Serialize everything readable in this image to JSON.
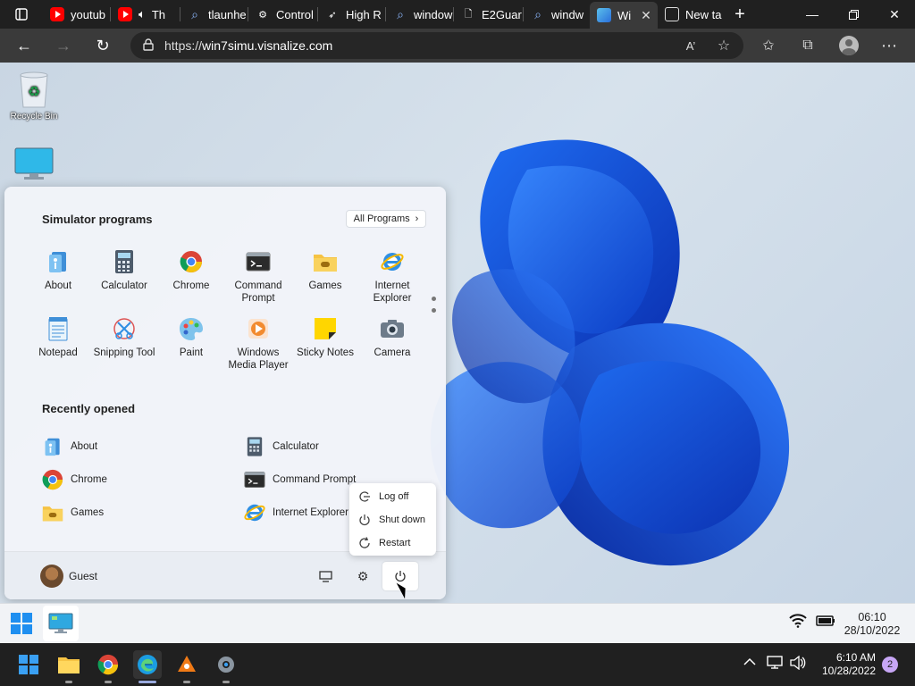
{
  "browser": {
    "tabs": [
      {
        "title": "youtub",
        "favicon": "youtube-icon"
      },
      {
        "title": "Th",
        "favicon": "youtube-icon"
      },
      {
        "title": "tlaunhe",
        "favicon": "search-icon"
      },
      {
        "title": "Control",
        "favicon": "control-icon"
      },
      {
        "title": "High R",
        "favicon": "cursor-icon"
      },
      {
        "title": "window",
        "favicon": "search-icon"
      },
      {
        "title": "E2Guar",
        "favicon": "page-icon"
      },
      {
        "title": "windw",
        "favicon": "search-icon"
      },
      {
        "title": "Wi",
        "favicon": "win7-icon",
        "active": true
      },
      {
        "title": "New ta",
        "favicon": "newtab-icon"
      }
    ],
    "url_scheme": "https://",
    "url_host": "win7simu.visnalize.com",
    "read_aloud_label": "A’",
    "accent": "#3a3a3a"
  },
  "desktop": {
    "icons": [
      {
        "label": "Recycle Bin"
      },
      {
        "label": ""
      }
    ]
  },
  "start_menu": {
    "section_programs": "Simulator programs",
    "all_programs_label": "All Programs",
    "programs": [
      {
        "label": "About",
        "icon": "about-icon"
      },
      {
        "label": "Calculator",
        "icon": "calculator-icon"
      },
      {
        "label": "Chrome",
        "icon": "chrome-icon"
      },
      {
        "label": "Command Prompt",
        "icon": "cmd-icon"
      },
      {
        "label": "Games",
        "icon": "games-icon"
      },
      {
        "label": "Internet Explorer",
        "icon": "ie-icon"
      },
      {
        "label": "Notepad",
        "icon": "notepad-icon"
      },
      {
        "label": "Snipping Tool",
        "icon": "snipping-icon"
      },
      {
        "label": "Paint",
        "icon": "paint-icon"
      },
      {
        "label": "Windows Media Player",
        "icon": "media-player-icon"
      },
      {
        "label": "Sticky Notes",
        "icon": "sticky-notes-icon"
      },
      {
        "label": "Camera",
        "icon": "camera-icon"
      }
    ],
    "section_recent": "Recently opened",
    "recent": [
      {
        "label": "About",
        "icon": "about-icon"
      },
      {
        "label": "Calculator",
        "icon": "calculator-icon"
      },
      {
        "label": "Chrome",
        "icon": "chrome-icon"
      },
      {
        "label": "Command Prompt",
        "icon": "cmd-icon"
      },
      {
        "label": "Games",
        "icon": "games-icon"
      },
      {
        "label": "Internet Explorer",
        "icon": "ie-icon"
      }
    ],
    "user": "Guest",
    "power_menu": [
      {
        "label": "Log off",
        "icon": "logoff-icon"
      },
      {
        "label": "Shut down",
        "icon": "shutdown-icon"
      },
      {
        "label": "Restart",
        "icon": "restart-icon"
      }
    ]
  },
  "sim_taskbar": {
    "time": "06:10",
    "date": "28/10/2022"
  },
  "win_taskbar": {
    "time": "6:10 AM",
    "date": "10/28/2022",
    "notifications": "2"
  }
}
